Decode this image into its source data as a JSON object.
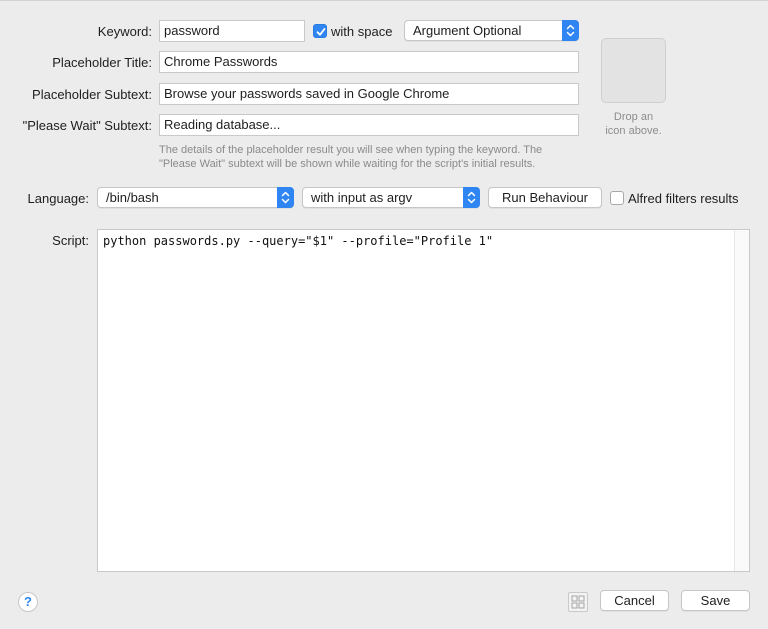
{
  "form": {
    "keyword_label": "Keyword:",
    "keyword_value": "password",
    "with_space_label": "with space",
    "with_space_checked": true,
    "argument_option": "Argument Optional",
    "placeholder_title_label": "Placeholder Title:",
    "placeholder_title_value": "Chrome Passwords",
    "placeholder_subtext_label": "Placeholder Subtext:",
    "placeholder_subtext_value": "Browse your passwords saved in Google Chrome",
    "please_wait_label": "\"Please Wait\" Subtext:",
    "please_wait_value": "Reading database...",
    "help_text_line1": "The details of the placeholder result you will see when typing the keyword. The",
    "help_text_line2": "\"Please Wait\" subtext will be shown while waiting for the script's initial results."
  },
  "icon_well": {
    "hint_line1": "Drop an",
    "hint_line2": "icon above."
  },
  "language": {
    "label": "Language:",
    "value": "/bin/bash",
    "input_mode": "with input as argv",
    "run_behaviour_label": "Run Behaviour",
    "alfred_filters_label": "Alfred filters results",
    "alfred_filters_checked": false
  },
  "script": {
    "label": "Script:",
    "content": "python passwords.py --query=\"$1\" --profile=\"Profile 1\""
  },
  "footer": {
    "help_label": "?",
    "cancel_label": "Cancel",
    "save_label": "Save"
  },
  "colors": {
    "accent": "#2f86f2",
    "background": "#ececec"
  }
}
